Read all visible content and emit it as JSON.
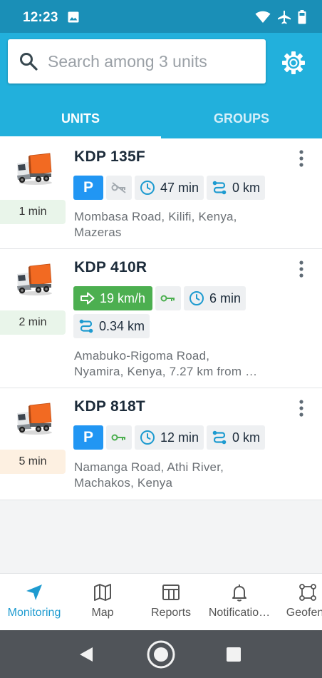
{
  "status_bar": {
    "time": "12:23"
  },
  "search": {
    "placeholder": "Search among 3 units"
  },
  "tabs": [
    {
      "label": "UNITS",
      "active": true
    },
    {
      "label": "GROUPS",
      "active": false
    }
  ],
  "units": [
    {
      "name": "KDP 135F",
      "age": "1 min",
      "state": "parked",
      "duration": "47 min",
      "distance": "0 km",
      "address_line1": "Mombasa Road, Kilifi, Kenya,",
      "address_line2": "Mazeras"
    },
    {
      "name": "KDP 410R",
      "age": "2 min",
      "state": "moving",
      "speed": "19 km/h",
      "duration": "6 min",
      "distance": "0.34 km",
      "address_line1": "Amabuko-Rigoma Road,",
      "address_line2": "Nyamira, Kenya, 7.27 km from …"
    },
    {
      "name": "KDP 818T",
      "age": "5 min",
      "state": "parked",
      "duration": "12 min",
      "distance": "0 km",
      "address_line1": "Namanga Road, Athi River,",
      "address_line2": "Machakos, Kenya"
    }
  ],
  "park_label": "P",
  "bottom_nav": [
    {
      "label": "Monitoring",
      "icon": "navigation-arrow-icon",
      "active": true
    },
    {
      "label": "Map",
      "icon": "map-icon",
      "active": false
    },
    {
      "label": "Reports",
      "icon": "table-icon",
      "active": false
    },
    {
      "label": "Notificatio…",
      "icon": "bell-icon",
      "active": false
    },
    {
      "label": "Geofenc",
      "icon": "geofence-icon",
      "active": false
    }
  ],
  "colors": {
    "status_bar": "#1a8fb7",
    "header": "#22b0dc",
    "accent": "#1e9bd0",
    "parked": "#2196f3",
    "moving": "#4caf50",
    "ignition_on": "#4caf50",
    "age_fresh": "#e9f5ea",
    "age_stale": "#fdf0e1"
  }
}
